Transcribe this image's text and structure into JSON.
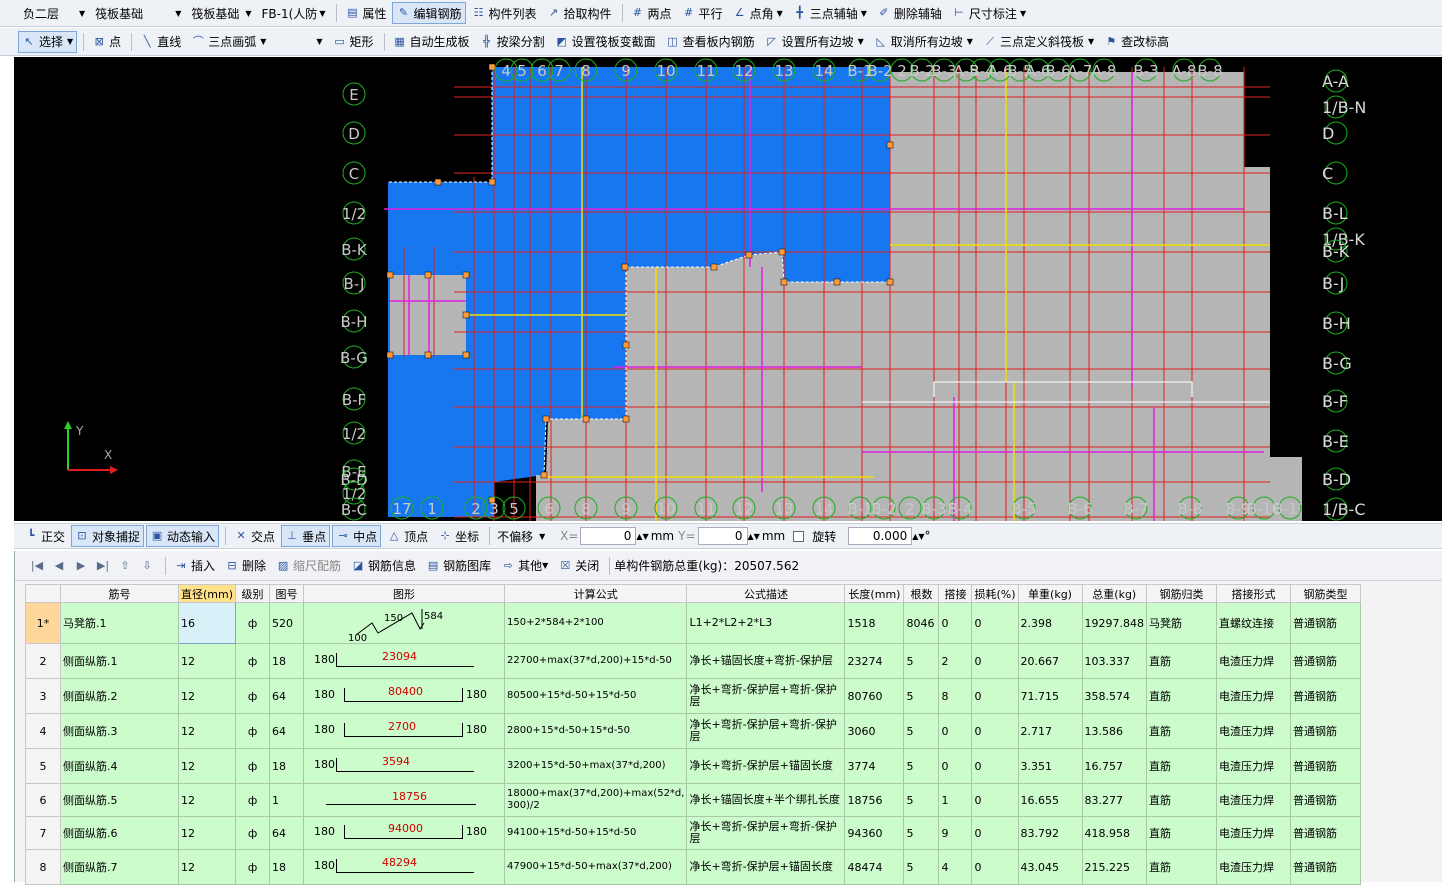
{
  "toolbar1": {
    "floor": "负二层",
    "category": "筏板基础",
    "type": "筏板基础",
    "component": "FB-1(人防",
    "attr": "属性",
    "edit_rebar": "编辑钢筋",
    "comp_list": "构件列表",
    "pick_comp": "拾取构件",
    "two_point": "两点",
    "parallel": "平行",
    "point_angle": "点角",
    "three_point_aux": "三点辅轴",
    "delete_aux": "删除辅轴",
    "dim": "尺寸标注"
  },
  "toolbar2": {
    "select": "选择",
    "point": "点",
    "line": "直线",
    "arc": "三点画弧",
    "rect": "矩形",
    "auto_gen": "自动生成板",
    "split_beam": "按梁分割",
    "set_section": "设置筏板变截面",
    "view_rebar": "查看板内钢筋",
    "set_all_slope": "设置所有边坡",
    "cancel_all_slope": "取消所有边坡",
    "three_point_slope": "三点定义斜筏板",
    "check_elev": "查改标高"
  },
  "canvas": {
    "top_axes": [
      "4",
      "5",
      "6",
      "7",
      "8",
      "9",
      "10",
      "11",
      "12",
      "13",
      "14",
      "B-1",
      "B-2",
      "2",
      "B-2",
      "B-3",
      "A-5",
      "B-4",
      "A-6",
      "B-5",
      "A-6",
      "B-6",
      "A-7",
      "A-8",
      "B-3",
      "A-8",
      "B-8"
    ],
    "bottom_axes": [
      "17",
      "1",
      "2",
      "3",
      "5",
      "6",
      "8",
      "9",
      "10",
      "11",
      "12",
      "13",
      "14",
      "B-1",
      "B-2",
      "2",
      "B-3",
      "B-4",
      "B-5",
      "B-6",
      "B-7",
      "B-8",
      "B-9",
      "B-10",
      "B-11"
    ],
    "left_axes": [
      "E",
      "D",
      "C",
      "1/2",
      "B-K",
      "B-J",
      "B-H",
      "B-G",
      "B-F",
      "1/2",
      "B-E",
      "B-D",
      "1/2",
      "B-C"
    ],
    "right_axes": [
      "A-A",
      "1/B-N",
      "D",
      "C",
      "B-L",
      "1/B-K",
      "B-K",
      "B-J",
      "B-H",
      "B-G",
      "B-F",
      "B-E",
      "B-D",
      "1/B-C"
    ],
    "ucs_y": "Y",
    "ucs_x": "X"
  },
  "snapbar": {
    "ortho": "正交",
    "obj_snap": "对象捕捉",
    "dyn_input": "动态输入",
    "intersect": "交点",
    "perp": "垂点",
    "mid": "中点",
    "vertex": "顶点",
    "coord": "坐标",
    "offset_mode": "不偏移",
    "x_label": "X=",
    "x_val": "0",
    "mm1": "mm",
    "y_label": "Y=",
    "y_val": "0",
    "mm2": "mm",
    "rotate": "旋转",
    "rot_val": "0.000",
    "deg": "°"
  },
  "rebar_bar": {
    "insert": "插入",
    "delete": "删除",
    "scale_rebar": "缩尺配筋",
    "rebar_info": "钢筋信息",
    "rebar_lib": "钢筋图库",
    "other": "其他",
    "close": "关闭",
    "total_label": "单构件钢筋总重(kg)：20507.562"
  },
  "table": {
    "headers": [
      "筋号",
      "直径(mm)",
      "级别",
      "图号",
      "图形",
      "计算公式",
      "公式描述",
      "长度(mm)",
      "根数",
      "搭接",
      "损耗(%)",
      "单重(kg)",
      "总重(kg)",
      "钢筋归类",
      "搭接形式",
      "钢筋类型"
    ],
    "rows": [
      {
        "no": "1*",
        "name": "马凳筋.1",
        "dia": "16",
        "grade": "ф",
        "fig": "520",
        "shape": {
          "kind": "chair",
          "a": "150",
          "b": "584",
          "c": "100"
        },
        "formula": "150+2*584+2*100",
        "desc": "L1+2*L2+2*L3",
        "len": "1518",
        "count": "8046",
        "lap": "0",
        "loss": "0",
        "unit": "2.398",
        "total": "19297.848",
        "cat": "马凳筋",
        "lapform": "直螺纹连接",
        "type": "普通钢筋"
      },
      {
        "no": "2",
        "name": "侧面纵筋.1",
        "dia": "12",
        "grade": "ф",
        "fig": "18",
        "shape": {
          "kind": "L",
          "left": "180",
          "mid": "23094",
          "right": ""
        },
        "formula": "22700+max(37*d,200)+15*d-50",
        "desc": "净长+锚固长度+弯折-保护层",
        "len": "23274",
        "count": "5",
        "lap": "2",
        "loss": "0",
        "unit": "20.667",
        "total": "103.337",
        "cat": "直筋",
        "lapform": "电渣压力焊",
        "type": "普通钢筋"
      },
      {
        "no": "3",
        "name": "侧面纵筋.2",
        "dia": "12",
        "grade": "ф",
        "fig": "64",
        "shape": {
          "kind": "U",
          "left": "180",
          "mid": "80400",
          "right": "180"
        },
        "formula": "80500+15*d-50+15*d-50",
        "desc": "净长+弯折-保护层+弯折-保护层",
        "len": "80760",
        "count": "5",
        "lap": "8",
        "loss": "0",
        "unit": "71.715",
        "total": "358.574",
        "cat": "直筋",
        "lapform": "电渣压力焊",
        "type": "普通钢筋"
      },
      {
        "no": "4",
        "name": "侧面纵筋.3",
        "dia": "12",
        "grade": "ф",
        "fig": "64",
        "shape": {
          "kind": "U",
          "left": "180",
          "mid": "2700",
          "right": "180"
        },
        "formula": "2800+15*d-50+15*d-50",
        "desc": "净长+弯折-保护层+弯折-保护层",
        "len": "3060",
        "count": "5",
        "lap": "0",
        "loss": "0",
        "unit": "2.717",
        "total": "13.586",
        "cat": "直筋",
        "lapform": "电渣压力焊",
        "type": "普通钢筋"
      },
      {
        "no": "5",
        "name": "侧面纵筋.4",
        "dia": "12",
        "grade": "ф",
        "fig": "18",
        "shape": {
          "kind": "L",
          "left": "180",
          "mid": "3594",
          "right": ""
        },
        "formula": "3200+15*d-50+max(37*d,200)",
        "desc": "净长+弯折-保护层+锚固长度",
        "len": "3774",
        "count": "5",
        "lap": "0",
        "loss": "0",
        "unit": "3.351",
        "total": "16.757",
        "cat": "直筋",
        "lapform": "电渣压力焊",
        "type": "普通钢筋"
      },
      {
        "no": "6",
        "name": "侧面纵筋.5",
        "dia": "12",
        "grade": "ф",
        "fig": "1",
        "shape": {
          "kind": "I",
          "left": "",
          "mid": "18756",
          "right": ""
        },
        "formula": "18000+max(37*d,200)+max(52*d, 300)/2",
        "desc": "净长+锚固长度+半个绑扎长度",
        "len": "18756",
        "count": "5",
        "lap": "1",
        "loss": "0",
        "unit": "16.655",
        "total": "83.277",
        "cat": "直筋",
        "lapform": "电渣压力焊",
        "type": "普通钢筋"
      },
      {
        "no": "7",
        "name": "侧面纵筋.6",
        "dia": "12",
        "grade": "ф",
        "fig": "64",
        "shape": {
          "kind": "U",
          "left": "180",
          "mid": "94000",
          "right": "180"
        },
        "formula": "94100+15*d-50+15*d-50",
        "desc": "净长+弯折-保护层+弯折-保护层",
        "len": "94360",
        "count": "5",
        "lap": "9",
        "loss": "0",
        "unit": "83.792",
        "total": "418.958",
        "cat": "直筋",
        "lapform": "电渣压力焊",
        "type": "普通钢筋"
      },
      {
        "no": "8",
        "name": "侧面纵筋.7",
        "dia": "12",
        "grade": "ф",
        "fig": "18",
        "shape": {
          "kind": "L",
          "left": "180",
          "mid": "48294",
          "right": ""
        },
        "formula": "47900+15*d-50+max(37*d,200)",
        "desc": "净长+弯折-保护层+锚固长度",
        "len": "48474",
        "count": "5",
        "lap": "4",
        "loss": "0",
        "unit": "43.045",
        "total": "215.225",
        "cat": "直筋",
        "lapform": "电渣压力焊",
        "type": "普通钢筋"
      }
    ]
  }
}
